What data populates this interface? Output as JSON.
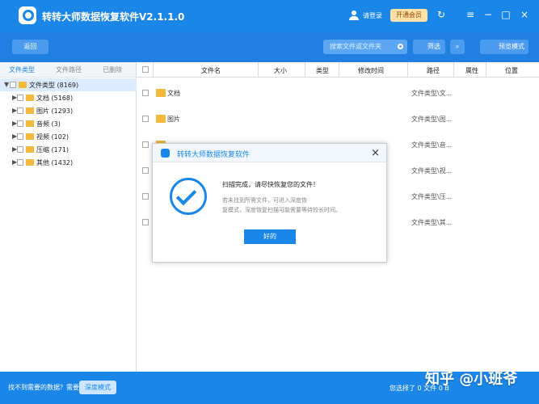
{
  "window": {
    "title": "转转大师数据恢复软件V2.1.1.0",
    "login_label": "请登录",
    "vip_label": "开通会员"
  },
  "toolbar": {
    "back_label": "返回",
    "search_placeholder": "搜索文件或文件夹",
    "filter_label": "筛选",
    "preview_label": "预览模式"
  },
  "sidebar": {
    "tabs": [
      "文件类型",
      "文件路径",
      "已删除"
    ],
    "tree": [
      "文件类型 (8169)",
      "文档 (5168)",
      "图片 (1293)",
      "音频 (3)",
      "视频 (102)",
      "压缩 (171)",
      "其他 (1432)"
    ]
  },
  "table": {
    "headers": [
      "文件名",
      "大小",
      "类型",
      "修改时间",
      "路径",
      "属性",
      "位置"
    ],
    "rows": [
      {
        "name": "文档",
        "path": "文件类型\\文..."
      },
      {
        "name": "图片",
        "path": "文件类型\\图..."
      },
      {
        "name": "",
        "path": "文件类型\\音..."
      },
      {
        "name": "",
        "path": "文件类型\\视..."
      },
      {
        "name": "",
        "path": "文件类型\\压..."
      },
      {
        "name": "",
        "path": "文件类型\\其..."
      }
    ]
  },
  "dialog": {
    "title": "转转大师数据恢复软件",
    "message": "扫描完成，请尽快恢复您的文件！",
    "sub_line_1": "若未找到所需文件，可进入深度恢",
    "sub_line_2": "复模式，深度恢复扫描可能需要等待较长时间。",
    "ok_label": "好的"
  },
  "bottom": {
    "hint": "找不到需要的数据？需要",
    "deep_mode_label": "深度模式",
    "selected_text": "您选择了 0 文件 0 B",
    "watermark": "知乎 @小班爷"
  },
  "colors": {
    "primary": "#1a86e8",
    "sidebar_selected": "#dcebff"
  }
}
